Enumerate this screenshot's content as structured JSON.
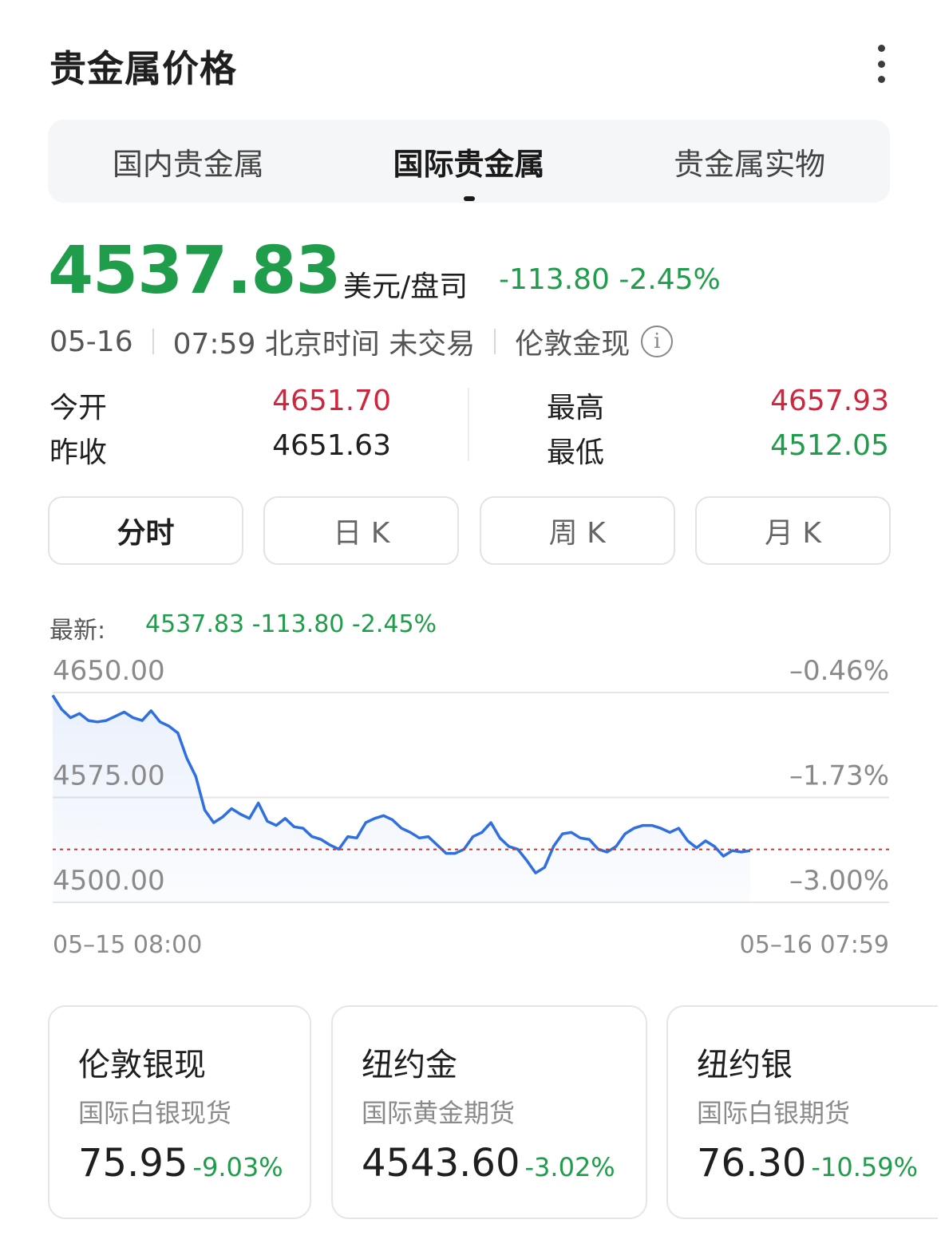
{
  "header": {
    "title": "贵金属价格"
  },
  "tabs": [
    {
      "label": "国内贵金属",
      "active": false
    },
    {
      "label": "国际贵金属",
      "active": true
    },
    {
      "label": "贵金属实物",
      "active": false
    }
  ],
  "quote": {
    "price": "4537.83",
    "unit": "美元/盘司",
    "change": "-113.80 -2.45%",
    "date": "05-16",
    "time_status": "07:59 北京时间 未交易",
    "instrument": "伦敦金现",
    "info_icon": "i"
  },
  "stats": {
    "open_label": "今开",
    "open_value": "4651.70",
    "prev_close_label": "昨收",
    "prev_close_value": "4651.63",
    "high_label": "最高",
    "high_value": "4657.93",
    "low_label": "最低",
    "low_value": "4512.05"
  },
  "kline_tabs": [
    {
      "label": "分时",
      "active": true
    },
    {
      "label": "日 K",
      "active": false
    },
    {
      "label": "周 K",
      "active": false
    },
    {
      "label": "月 K",
      "active": false
    }
  ],
  "latest": {
    "label": "最新:",
    "value": "4537.83 -113.80 -2.45%"
  },
  "colors": {
    "up": "#d0263d",
    "down": "#1f9d4a",
    "line": "#2f6fdf",
    "ref_line": "#c0392b"
  },
  "chart_data": {
    "type": "line",
    "title": "",
    "xlabel": "",
    "ylabel": "",
    "x_range": [
      "05–15 08:00",
      "05–16 07:59"
    ],
    "ylim": [
      4500.0,
      4650.0
    ],
    "y_ticks": [
      "4650.00",
      "4575.00",
      "4500.00"
    ],
    "y_ticks_right": [
      "–0.46%",
      "–1.73%",
      "–3.00%"
    ],
    "reference_line": 4537.83,
    "grid": true,
    "series": [
      {
        "values": [
          4648,
          4638,
          4632,
          4635,
          4630,
          4629,
          4630,
          4633,
          4636,
          4632,
          4630,
          4637,
          4629,
          4626,
          4621,
          4603,
          4590,
          4566,
          4557,
          4561,
          4567,
          4563,
          4560,
          4571,
          4558,
          4555,
          4560,
          4554,
          4553,
          4547,
          4545,
          4541,
          4538,
          4547,
          4546,
          4557,
          4560,
          4562,
          4559,
          4553,
          4550,
          4546,
          4547,
          4541,
          4535,
          4535,
          4538,
          4547,
          4550,
          4557,
          4546,
          4540,
          4538,
          4530,
          4521,
          4525,
          4540,
          4549,
          4550,
          4546,
          4545,
          4538,
          4536,
          4540,
          4549,
          4553,
          4555,
          4555,
          4553,
          4550,
          4553,
          4544,
          4539,
          4544,
          4540,
          4533,
          4537,
          4536,
          4537
        ]
      }
    ]
  },
  "mini_cards": [
    {
      "name": "伦敦银现",
      "subtitle": "国际白银现货",
      "price": "75.95",
      "pct": "-9.03%"
    },
    {
      "name": "纽约金",
      "subtitle": "国际黄金期货",
      "price": "4543.60",
      "pct": "-3.02%"
    },
    {
      "name": "纽约银",
      "subtitle": "国际白银期货",
      "price": "76.30",
      "pct": "-10.59%"
    }
  ]
}
